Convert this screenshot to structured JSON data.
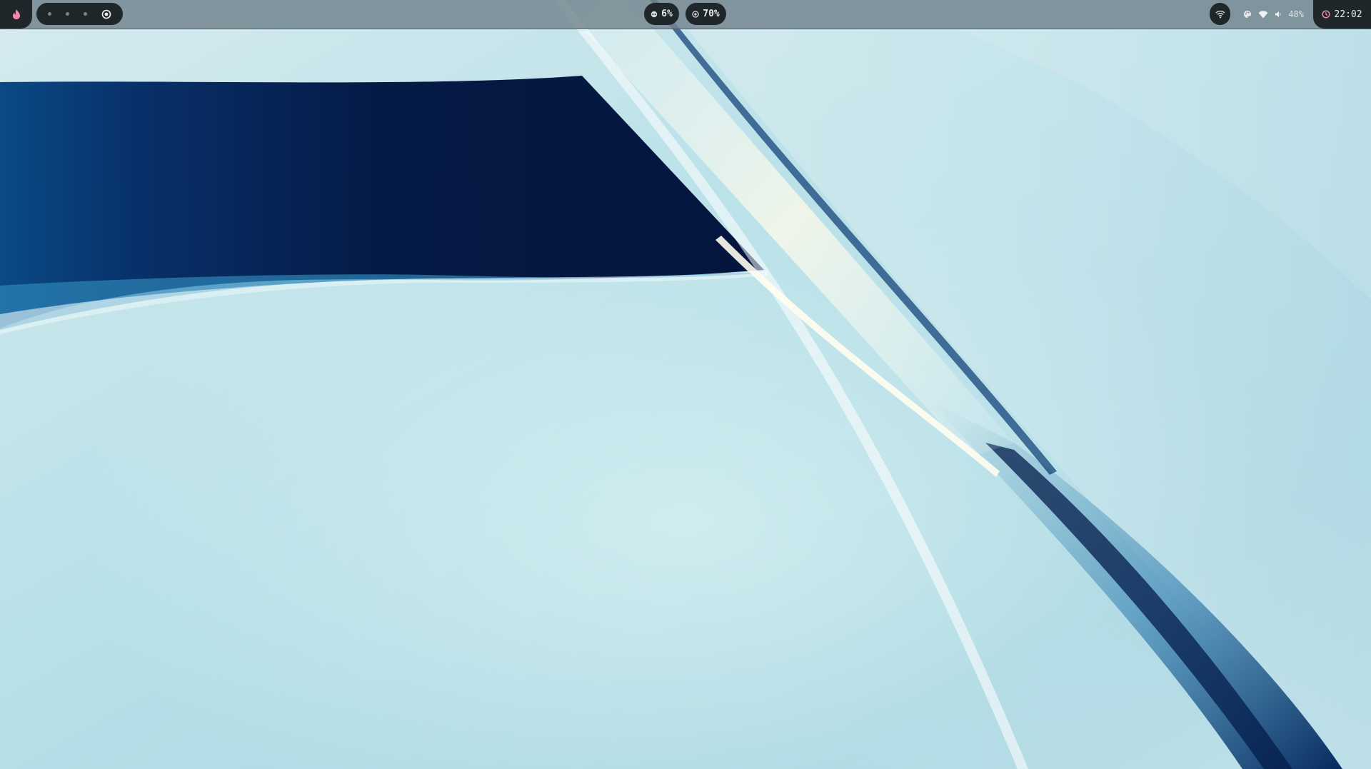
{
  "desktop": {
    "wallpaper": "abstract-blue-wave-wallpaper"
  },
  "topbar": {
    "launcher": {
      "icon": "flame-icon",
      "color": "#f08aa8"
    },
    "workspaces": {
      "count": 4,
      "active_index": 3
    },
    "cpu": {
      "icon": "cpu-icon",
      "value": "6%"
    },
    "memory": {
      "icon": "memory-icon",
      "value": "70%"
    },
    "tray": {
      "network_icon": "wifi-icon",
      "theme_icon": "palette-icon",
      "wifi_icon": "wifi-signal-icon",
      "volume_icon": "volume-icon",
      "volume_value": "48%"
    },
    "clock": {
      "icon": "clock-icon",
      "time": "22:02",
      "accent": "#f08aa8"
    }
  }
}
